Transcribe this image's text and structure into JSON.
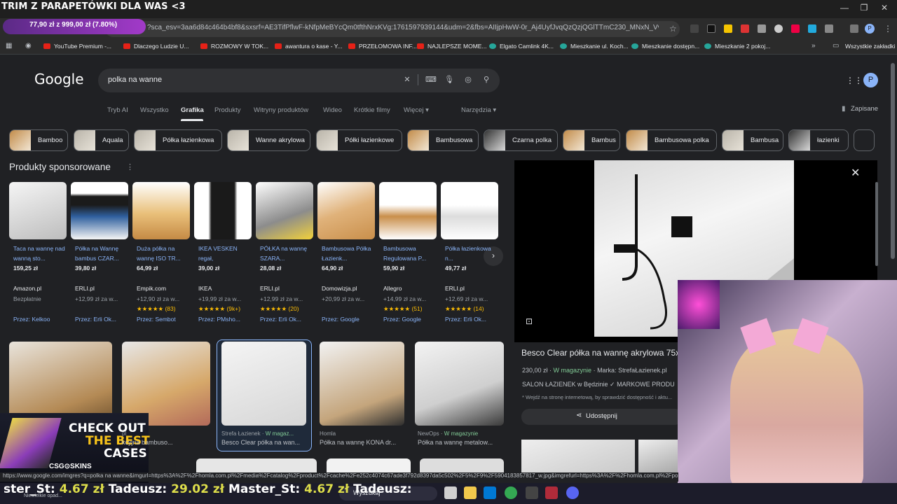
{
  "overlay": {
    "stream_title": "TRIM Z PARAPETÓWKI DLA WAS <3",
    "donation_goal": "77,90 zł z 999,00 zł (7.80%)",
    "ticker": [
      {
        "name": "ster_St:",
        "value": "4.67 zł"
      },
      {
        "name": "Tadeusz:",
        "value": "29.02 zł"
      },
      {
        "name": "Master_St:",
        "value": "4.67 zł"
      },
      {
        "name": "Tadeusz:",
        "value": ""
      }
    ],
    "ad": {
      "line1": "CHECK OUT",
      "line2": "THE BEST",
      "line3": "CASES",
      "brand": "CSG⊙SKINS"
    }
  },
  "browser": {
    "url": "?sca_esv=3aa6d84c464b4bf8&sxsrf=AE3TifPflwF-kNfpMeBYcQm0tfthNrxKVg:1761597939144&udm=2&fbs=AIIjpHwW-0r_Aj4UyfJvqQzQzjQGlTTmC230_MNxN_VvYo5ocP5b9EYS...",
    "bookmarks": [
      {
        "label": "YouTube Premium -...",
        "icon": "youtube"
      },
      {
        "label": "Dlaczego Ludzie U...",
        "icon": "youtube"
      },
      {
        "label": "ROZMOWY W TOK...",
        "icon": "youtube"
      },
      {
        "label": "awantura o kase - Y...",
        "icon": "youtube"
      },
      {
        "label": "PRZEŁOMOWA INF...",
        "icon": "youtube"
      },
      {
        "label": "NAJLEPSZE MOME...",
        "icon": "youtube"
      },
      {
        "label": "Elgato Camlink 4K...",
        "icon": "generic"
      },
      {
        "label": "Mieszkanie ul. Koch...",
        "icon": "otodom"
      },
      {
        "label": "Mieszkanie dostępn...",
        "icon": "otodom"
      },
      {
        "label": "Mieszkanie 2 pokoj...",
        "icon": "otodom"
      }
    ],
    "all_bookmarks": "Wszystkie zakładki",
    "status_url": "https://www.google.com/imgres?q=polka na wanne&imgurl=https%3A%2F%2Fhomla.com.pl%2Fmedia%2Fcatalog%2Fproduct%2Fcache%2Fe252c4074c67ade3f792d8397da5c502%2F5%2F9%2F5904183857817_w.jpg&imgrefurl=https%3A%2F%2Fhomla.com.pl%2Fpolka-na"
  },
  "google": {
    "logo": "Google",
    "query": "polka na wanne",
    "avatar": "P",
    "tabs": [
      "Tryb AI",
      "Wszystko",
      "Grafika",
      "Produkty",
      "Witryny produktów",
      "Wideo",
      "Krótkie filmy",
      "Więcej",
      "Narzędzia"
    ],
    "saved": "Zapisane",
    "chips": [
      "Bamboo",
      "Aquala",
      "Półka łazienkowa",
      "Wanne akrylowa",
      "Półki łazienkowe",
      "Bambusowa",
      "Czarna polka",
      "Bambus",
      "Bambusowa polka",
      "Bambusa",
      "łazienki"
    ],
    "sponsored_title": "Produkty sponsorowane",
    "products": [
      {
        "name": "Taca na wannę nad wanną sto...",
        "price": "159,25 zł",
        "store": "Amazon.pl",
        "ship": "Bezpłatnie",
        "rating": "",
        "via": "Przez: Kelkoo"
      },
      {
        "name": "Półka na Wannę bambus CZAR...",
        "price": "39,80 zł",
        "store": "ERLI.pl",
        "ship": "+12,99 zł za w...",
        "rating": "",
        "via": "Przez: Erli Ok..."
      },
      {
        "name": "Duża półka na wannę ISO TR...",
        "price": "64,99 zł",
        "store": "Empik.com",
        "ship": "+12,90 zł za w...",
        "rating": "★★★★★ (83)",
        "via": "Przez: Sembot"
      },
      {
        "name": "IKEA VESKEN regał,",
        "price": "39,00 zł",
        "store": "IKEA",
        "ship": "+19,99 zł za w...",
        "rating": "★★★★★ (9k+)",
        "via": "Przez: PMsho..."
      },
      {
        "name": "PÓŁKA na wannę SZARA...",
        "price": "28,08 zł",
        "store": "ERLI.pl",
        "ship": "+12,99 zł za w...",
        "rating": "★★★★★ (20)",
        "via": "Przez: Erli Ok..."
      },
      {
        "name": "Bambusowa Półka Łazienk...",
        "price": "64,90 zł",
        "store": "Domowizja.pl",
        "ship": "+20,99 zł za w...",
        "rating": "",
        "via": "Przez: Google"
      },
      {
        "name": "Bambusowa Regulowana P...",
        "price": "59,90 zł",
        "store": "Allegro",
        "ship": "+14,99 zł za w...",
        "rating": "★★★★★ (51)",
        "via": "Przez: Google"
      },
      {
        "name": "Półka łazienkowa n...",
        "price": "49,77 zł",
        "store": "ERLI.pl",
        "ship": "+12,69 zł za w...",
        "rating": "★★★★★ (14)",
        "via": "Przez: Erli Ok..."
      }
    ],
    "grid": [
      {
        "source": "",
        "badge": "",
        "title": ""
      },
      {
        "source": "pl",
        "badge": "",
        "title": "kcyjna bambuso..."
      },
      {
        "source": "Strefa Łazienek",
        "badge": "W magaz...",
        "title": "Besco Clear półka na wan..."
      },
      {
        "source": "Homla",
        "badge": "",
        "title": "Półka na wannę KONA dr..."
      },
      {
        "source": "NewOps",
        "badge": "W magazynie",
        "title": "Półka na wannę metalow..."
      }
    ],
    "preview": {
      "title": "Besco Clear półka na wannę akrylowa 75x",
      "price": "230,00 zł",
      "stock": "W magazynie",
      "brand": "Marka: StrefaŁazienek.pl",
      "seller": "SALON ŁAZIENEK w Będzinie ✓ MARKOWE PRODU",
      "note": "* Wejdź na stronę internetową, by sprawdzić dostępność i aktu...",
      "share": "Udostępnij"
    }
  },
  "taskbar": {
    "search": "Wyszukaj",
    "weather": "Niewielkie opad..."
  }
}
